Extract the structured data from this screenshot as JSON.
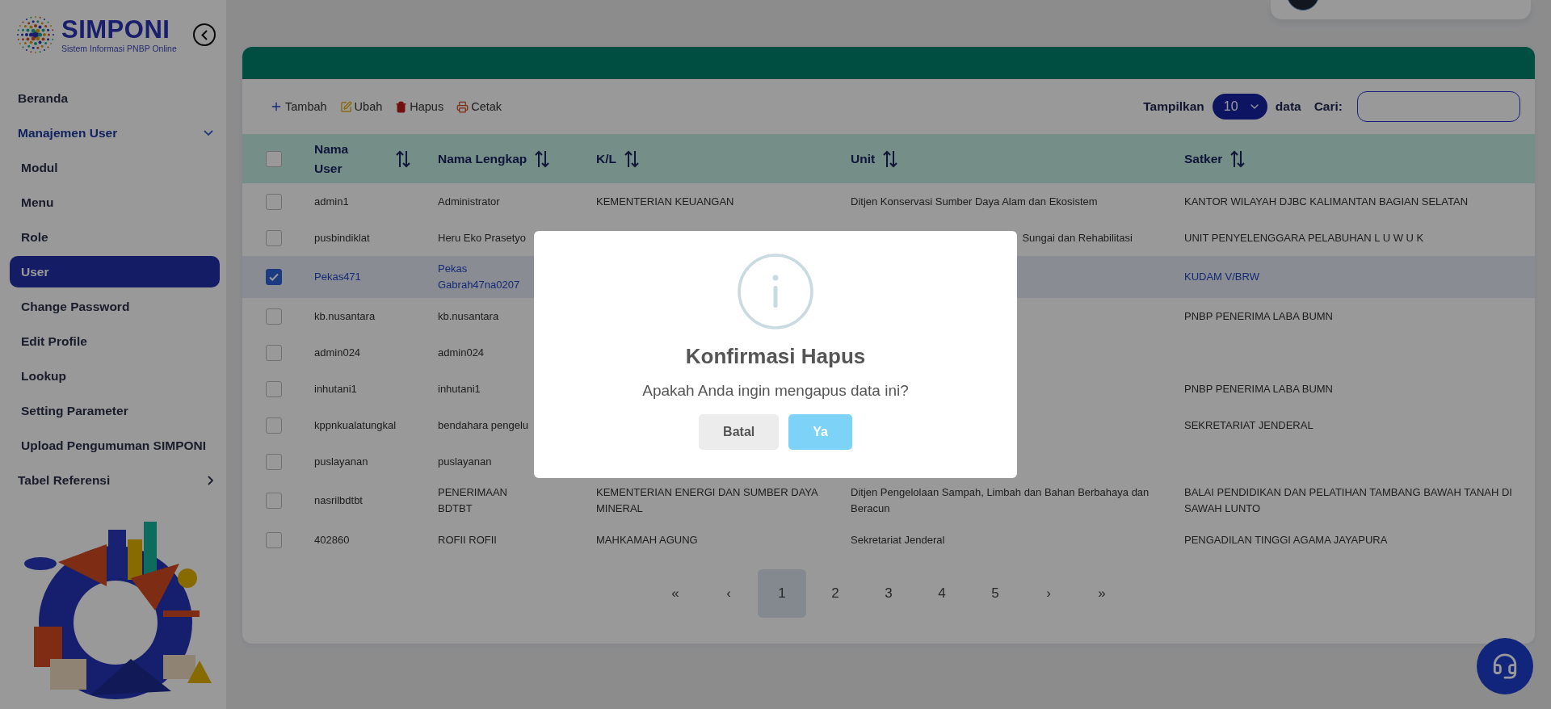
{
  "sidebar": {
    "logo": {
      "title": "SIMPONI",
      "subtitle": "Sistem Informasi PNBP Online"
    },
    "items": [
      {
        "label": "Beranda",
        "kind": "link",
        "selected": false
      },
      {
        "label": "Manajemen User",
        "kind": "group",
        "selected": false,
        "expanded": true,
        "children": [
          {
            "label": "Modul",
            "selected": false
          },
          {
            "label": "Menu",
            "selected": false
          },
          {
            "label": "Role",
            "selected": false
          },
          {
            "label": "User",
            "selected": true
          },
          {
            "label": "Change Password",
            "selected": false
          },
          {
            "label": "Edit Profile",
            "selected": false
          },
          {
            "label": "Lookup",
            "selected": false
          },
          {
            "label": "Setting Parameter",
            "selected": false
          },
          {
            "label": "Upload Pengumuman SIMPONI",
            "selected": false
          }
        ]
      },
      {
        "label": "Tabel Referensi",
        "kind": "group",
        "selected": false,
        "expanded": false
      }
    ]
  },
  "toolbar": {
    "actions": [
      {
        "label": "Tambah",
        "kind": "add"
      },
      {
        "label": "Ubah",
        "kind": "edit"
      },
      {
        "label": "Hapus",
        "kind": "delete"
      },
      {
        "label": "Cetak",
        "kind": "print"
      }
    ],
    "page_size": {
      "label": "Tampilkan",
      "value": "10",
      "suffix": "data"
    },
    "search": {
      "label": "Cari:"
    }
  },
  "table": {
    "header_checked": false,
    "columns": [
      "Nama User",
      "Nama Lengkap",
      "K/L",
      "Unit",
      "Satker"
    ],
    "rows": [
      {
        "checked": false,
        "selected": false,
        "cells": [
          {
            "text": "admin1"
          },
          {
            "text": "Administrator"
          },
          {
            "text": "KEMENTERIAN KEUANGAN"
          },
          {
            "text": "Ditjen Konservasi Sumber Daya Alam dan Ekosistem"
          },
          {
            "text": "KANTOR WILAYAH DJBC KALIMANTAN BAGIAN SELATAN"
          }
        ]
      },
      {
        "checked": false,
        "selected": false,
        "cells": [
          {
            "text": "pusbindiklat"
          },
          {
            "text": "Heru Eko Prasetyo"
          },
          null,
          {
            "text": "Sungai dan Rehabilitasi",
            "covered": true
          },
          {
            "text": "UNIT PENYELENGGARA PELABUHAN L U W U K"
          }
        ]
      },
      {
        "checked": true,
        "selected": true,
        "cells": [
          {
            "text": "Pekas471"
          },
          {
            "text": "Pekas Gabrah47na0207"
          },
          null,
          null,
          {
            "text": "KUDAM V/BRW"
          }
        ]
      },
      {
        "checked": false,
        "selected": false,
        "cells": [
          {
            "text": "kb.nusantara"
          },
          {
            "text": "kb.nusantara"
          },
          null,
          null,
          {
            "text": "PNBP PENERIMA LABA BUMN"
          }
        ]
      },
      {
        "checked": false,
        "selected": false,
        "cells": [
          {
            "text": "admin024"
          },
          {
            "text": "admin024"
          },
          null,
          null,
          null
        ]
      },
      {
        "checked": false,
        "selected": false,
        "cells": [
          {
            "text": "inhutani1"
          },
          {
            "text": "inhutani1"
          },
          null,
          null,
          {
            "text": "PNBP PENERIMA LABA BUMN"
          }
        ]
      },
      {
        "checked": false,
        "selected": false,
        "cells": [
          {
            "text": "kppnkualatungkal"
          },
          {
            "text": "bendahara pengelu"
          },
          null,
          null,
          {
            "text": "SEKRETARIAT JENDERAL"
          }
        ]
      },
      {
        "checked": false,
        "selected": false,
        "cells": [
          {
            "text": "puslayanan"
          },
          {
            "text": "puslayanan"
          },
          null,
          null,
          null
        ]
      },
      {
        "checked": false,
        "selected": false,
        "cells": [
          {
            "text": "nasrilbdtbt"
          },
          {
            "text": "PENERIMAAN BDTBT"
          },
          {
            "text": "KEMENTERIAN ENERGI DAN SUMBER DAYA MINERAL"
          },
          {
            "text": "Ditjen Pengelolaan Sampah, Limbah dan Bahan Berbahaya dan Beracun"
          },
          {
            "text": "BALAI PENDIDIKAN DAN PELATIHAN TAMBANG BAWAH TANAH DI SAWAH LUNTO"
          }
        ]
      },
      {
        "checked": false,
        "selected": false,
        "cells": [
          {
            "text": "402860"
          },
          {
            "text": "ROFII ROFII"
          },
          {
            "text": "MAHKAMAH AGUNG"
          },
          {
            "text": "Sekretariat Jenderal"
          },
          {
            "text": "PENGADILAN TINGGI AGAMA JAYAPURA"
          }
        ]
      }
    ]
  },
  "pagination": [
    {
      "label": "«",
      "selected": false
    },
    {
      "label": "‹",
      "selected": false
    },
    {
      "label": "1",
      "selected": true
    },
    {
      "label": "2",
      "selected": false
    },
    {
      "label": "3",
      "selected": false
    },
    {
      "label": "4",
      "selected": false
    },
    {
      "label": "5",
      "selected": false
    },
    {
      "label": "›",
      "selected": false
    },
    {
      "label": "»",
      "selected": false
    }
  ],
  "dialog": {
    "title": "Konfirmasi Hapus",
    "message": "Apakah Anda ingin mengapus data ini?",
    "buttons": [
      {
        "label": "Batal",
        "kind": "cancel"
      },
      {
        "label": "Ya",
        "kind": "confirm"
      }
    ]
  }
}
